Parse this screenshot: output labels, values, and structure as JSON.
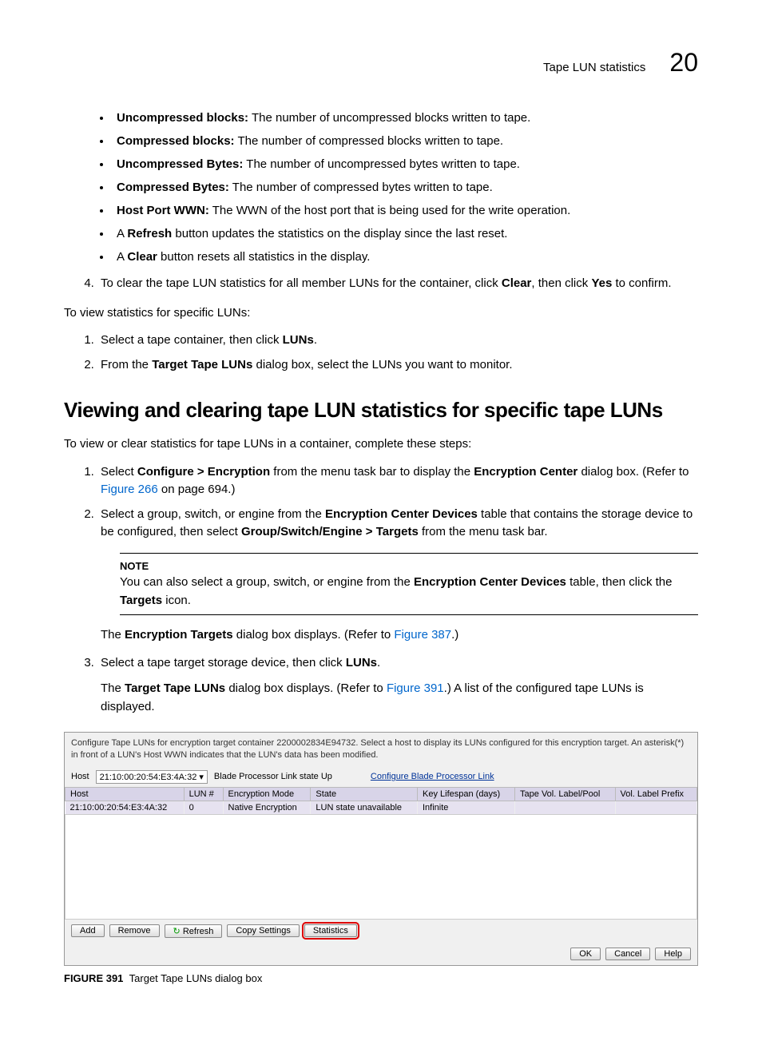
{
  "header": {
    "title": "Tape LUN statistics",
    "chapter": "20"
  },
  "bullets": [
    {
      "term": "Uncompressed blocks:",
      "desc": " The number of uncompressed blocks written to tape."
    },
    {
      "term": "Compressed blocks:",
      "desc": " The number of compressed blocks written to tape."
    },
    {
      "term": "Uncompressed Bytes:",
      "desc": " The number of uncompressed bytes written to tape."
    },
    {
      "term": "Compressed Bytes:",
      "desc": " The number of compressed bytes written to tape."
    },
    {
      "term": "Host Port WWN:",
      "desc": " The WWN of the host port that is being used for the write operation."
    }
  ],
  "bullets2": [
    {
      "pre": "A ",
      "bold": "Refresh",
      "post": " button updates the statistics on the display since the last reset."
    },
    {
      "pre": "A ",
      "bold": "Clear",
      "post": " button resets all statistics in the display."
    }
  ],
  "step4": {
    "num": "4.",
    "pre": "To clear the tape LUN statistics for all member LUNs for the container, click ",
    "b1": "Clear",
    "mid": ", then click ",
    "b2": "Yes",
    "post": " to confirm."
  },
  "viewIntro": "To view statistics for specific LUNs:",
  "viewSteps": [
    {
      "num": "1.",
      "pre": "Select a tape container, then click ",
      "b": "LUNs",
      "post": "."
    },
    {
      "num": "2.",
      "pre": "From the ",
      "b": "Target Tape LUNs",
      "post": " dialog box, select the LUNs you want to monitor."
    }
  ],
  "section": {
    "heading": "Viewing and clearing tape LUN statistics for specific tape LUNs",
    "intro": "To view or clear statistics for tape LUNs in a container, complete these steps:"
  },
  "mainSteps": {
    "s1": {
      "num": "1.",
      "pre": "Select ",
      "b1": "Configure > Encryption",
      "mid": " from the menu task bar to display the ",
      "b2": "Encryption Center",
      "post": " dialog box. (Refer to ",
      "link": "Figure 266",
      "post2": " on page 694.)"
    },
    "s2": {
      "num": "2.",
      "pre": "Select a group, switch, or engine from the ",
      "b1": "Encryption Center Devices",
      "mid": " table that contains the storage device to be configured, then select ",
      "b2": "Group/Switch/Engine > Targets",
      "post": " from the menu task bar."
    },
    "note": {
      "label": "NOTE",
      "pre": "You can also select a group, switch, or engine from the ",
      "b1": "Encryption Center Devices",
      "mid": " table, then click the ",
      "b2": "Targets",
      "post": " icon."
    },
    "s2after": {
      "pre": "The ",
      "b": "Encryption Targets",
      "mid": " dialog box displays. (Refer to ",
      "link": "Figure 387",
      "post": ".)"
    },
    "s3": {
      "num": "3.",
      "pre": "Select a tape target storage device, then click ",
      "b": "LUNs",
      "post": "."
    },
    "s3after": {
      "pre": "The ",
      "b": "Target Tape LUNs",
      "mid": " dialog box displays. (Refer to ",
      "link": "Figure 391",
      "post": ".) A list of the configured tape LUNs is displayed."
    }
  },
  "dialog": {
    "topText": "Configure Tape LUNs for encryption target container 2200002834E94732. Select a host to display its LUNs configured for this encryption target. An asterisk(*) in front of a LUN's Host WWN indicates that the LUN's data has been modified.",
    "hostLabel": "Host",
    "hostValue": "21:10:00:20:54:E3:4A:32 ▾",
    "bladeLabel": "Blade Processor Link state  Up",
    "configLink": "Configure Blade Processor Link",
    "columns": [
      "Host",
      "LUN #",
      "Encryption Mode",
      "State",
      "Key Lifespan (days)",
      "Tape Vol. Label/Pool",
      "Vol. Label Prefix"
    ],
    "row": [
      "21:10:00:20:54:E3:4A:32",
      "0",
      "Native Encryption",
      "LUN state unavailable",
      "Infinite",
      "",
      ""
    ],
    "buttons": {
      "add": "Add",
      "remove": "Remove",
      "refresh": "Refresh",
      "copy": "Copy Settings",
      "stats": "Statistics",
      "ok": "OK",
      "cancel": "Cancel",
      "help": "Help"
    }
  },
  "figureCaption": {
    "num": "FIGURE 391",
    "text": "Target Tape LUNs dialog box"
  }
}
